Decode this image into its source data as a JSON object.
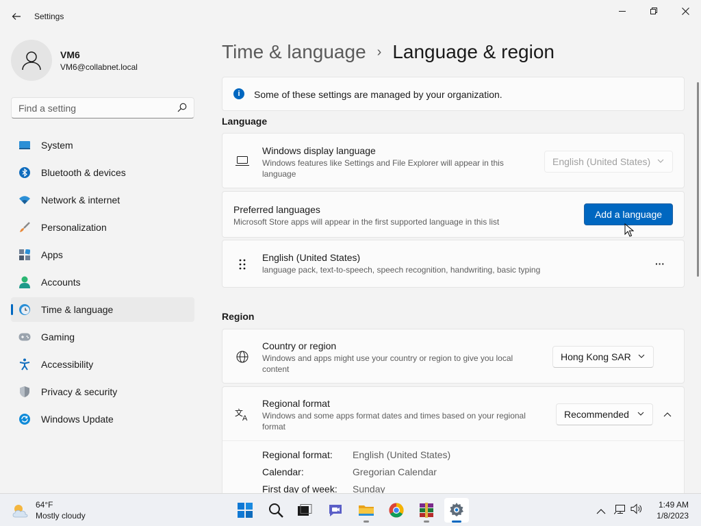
{
  "window": {
    "title": "Settings"
  },
  "profile": {
    "name": "VM6",
    "email": "VM6@collabnet.local"
  },
  "search": {
    "placeholder": "Find a setting"
  },
  "sidebar": {
    "items": [
      {
        "label": "System",
        "icon": "system-icon"
      },
      {
        "label": "Bluetooth & devices",
        "icon": "bluetooth-icon"
      },
      {
        "label": "Network & internet",
        "icon": "wifi-icon"
      },
      {
        "label": "Personalization",
        "icon": "brush-icon"
      },
      {
        "label": "Apps",
        "icon": "apps-icon"
      },
      {
        "label": "Accounts",
        "icon": "accounts-icon"
      },
      {
        "label": "Time & language",
        "icon": "clock-globe-icon",
        "active": true
      },
      {
        "label": "Gaming",
        "icon": "gamepad-icon"
      },
      {
        "label": "Accessibility",
        "icon": "accessibility-icon"
      },
      {
        "label": "Privacy & security",
        "icon": "shield-icon"
      },
      {
        "label": "Windows Update",
        "icon": "update-icon"
      }
    ]
  },
  "breadcrumb": {
    "parent": "Time & language",
    "separator": "›",
    "current": "Language & region"
  },
  "notice": {
    "text": "Some of these settings are managed by your organization."
  },
  "language_section": {
    "title": "Language",
    "display_language": {
      "title": "Windows display language",
      "description": "Windows features like Settings and File Explorer will appear in this language",
      "value": "English (United States)"
    },
    "preferred": {
      "title": "Preferred languages",
      "description": "Microsoft Store apps will appear in the first supported language in this list",
      "button": "Add a language"
    },
    "installed": {
      "title": "English (United States)",
      "description": "language pack, text-to-speech, speech recognition, handwriting, basic typing",
      "more": "···"
    }
  },
  "region_section": {
    "title": "Region",
    "country": {
      "title": "Country or region",
      "description": "Windows and apps might use your country or region to give you local content",
      "value": "Hong Kong SAR"
    },
    "format": {
      "title": "Regional format",
      "description": "Windows and some apps format dates and times based on your regional format",
      "value": "Recommended",
      "details": [
        {
          "label": "Regional format:",
          "value": "English (United States)"
        },
        {
          "label": "Calendar:",
          "value": "Gregorian Calendar"
        },
        {
          "label": "First day of week:",
          "value": "Sunday"
        }
      ]
    }
  },
  "taskbar": {
    "weather": {
      "temp": "64°F",
      "condition": "Mostly cloudy"
    },
    "clock": {
      "time": "1:49 AM",
      "date": "1/8/2023"
    }
  },
  "colors": {
    "accent": "#0067c0"
  }
}
